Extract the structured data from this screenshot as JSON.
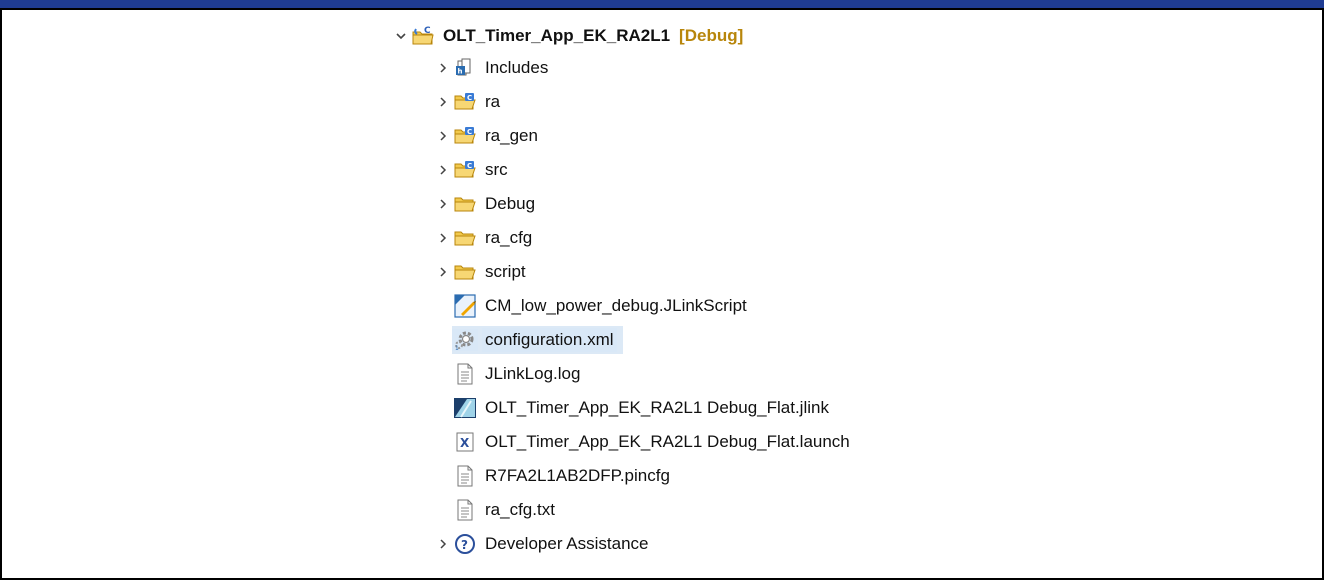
{
  "project": {
    "name": "OLT_Timer_App_EK_RA2L1",
    "decoration": "[Debug]"
  },
  "items": [
    {
      "label": "Includes"
    },
    {
      "label": "ra"
    },
    {
      "label": "ra_gen"
    },
    {
      "label": "src"
    },
    {
      "label": "Debug"
    },
    {
      "label": "ra_cfg"
    },
    {
      "label": "script"
    },
    {
      "label": "CM_low_power_debug.JLinkScript"
    },
    {
      "label": "configuration.xml"
    },
    {
      "label": "JLinkLog.log"
    },
    {
      "label": "OLT_Timer_App_EK_RA2L1 Debug_Flat.jlink"
    },
    {
      "label": "OLT_Timer_App_EK_RA2L1 Debug_Flat.launch"
    },
    {
      "label": "R7FA2L1AB2DFP.pincfg"
    },
    {
      "label": "ra_cfg.txt"
    },
    {
      "label": "Developer Assistance"
    }
  ],
  "icons": {
    "project": "c-project-folder-icon",
    "includes": "includes-icon",
    "source_folder": "c-source-folder-icon",
    "folder": "folder-icon",
    "jlinkscript": "jlink-script-icon",
    "config": "gear-config-icon",
    "text_file": "text-file-icon",
    "jlink": "jlink-file-icon",
    "launch": "launch-file-icon",
    "help": "question-circle-icon"
  },
  "colors": {
    "top_bar": "#1f3c93",
    "decoration": "#b8860b",
    "selection": "#d9e8f7",
    "folder": "#f2c94c"
  }
}
